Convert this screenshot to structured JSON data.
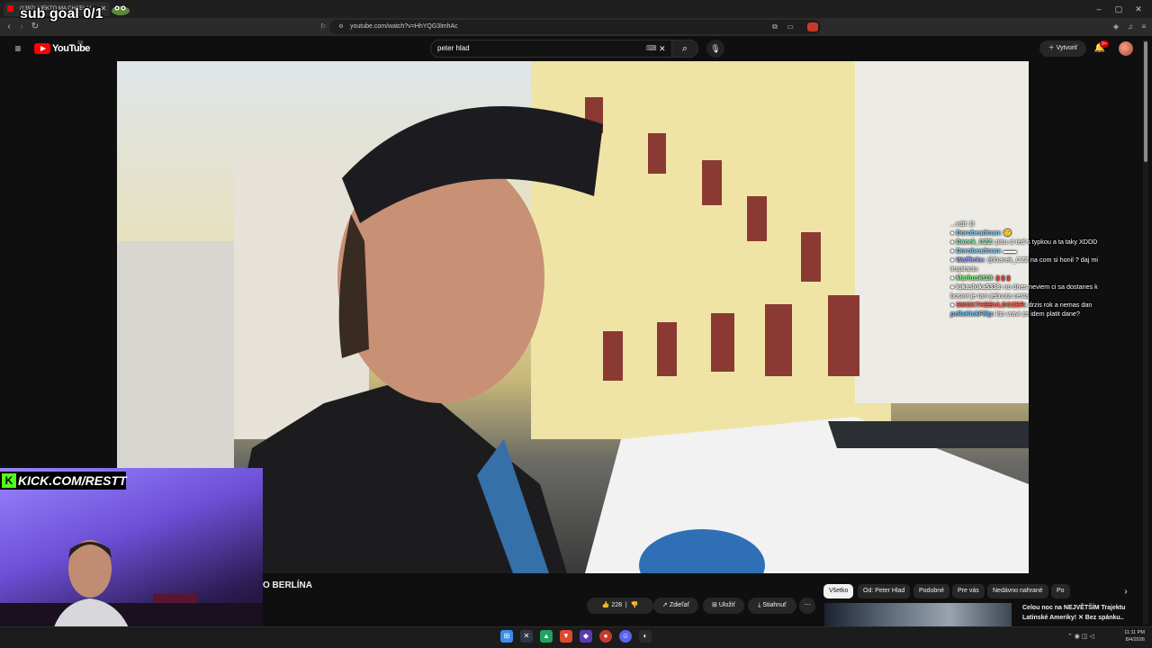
{
  "browser": {
    "tab_title": "(1397) NIEKTO MA CHCEL V...",
    "url": "youtube.com/watch?v=HhYQG3lmhAc"
  },
  "overlay": {
    "sub_goal": "sub goal 0/1",
    "kick_text": "KICK.COM/RESTT",
    "kick_logo": "K"
  },
  "youtube": {
    "logo_text": "YouTube",
    "region": "SK",
    "search_value": "peter hlad",
    "create_label": "Vytvoriť",
    "notif_badge": "9+"
  },
  "chat": [
    {
      "user": "",
      "msg": "...xdd :D",
      "color": "#ffffff"
    },
    {
      "user": "Dorobeadman:",
      "msg": "🙂",
      "color": "#7fd4ff"
    },
    {
      "user": "Danek_CZZ:",
      "msg": "pisu si teď s typkou a ta taky XDDD",
      "color": "#7fffb0"
    },
    {
      "user": "Dorobeadman:",
      "msg": "▬▬",
      "color": "#7fd4ff"
    },
    {
      "user": "WaffleXx:",
      "msg": "@Danek_CZZ na com si honil ? daj mi inspiraciu",
      "color": "#9aa8ff"
    },
    {
      "user": "Marhuskt19:",
      "msg": "▮ ▮ ▮",
      "color": "#7fff7f"
    },
    {
      "user": "lukasluka5338:",
      "msg": "no dnes neviem ci sa dostanes k bosovi je tam jebnuta cesta",
      "color": "#ffffff"
    },
    {
      "user": "SMOKTHEBULDOZER:",
      "msg": "drzis rok a nemas dan",
      "color": "#ff5a4a"
    },
    {
      "user": "pellxKickFilip:",
      "msg": "kto vravi ze idem platit dane?",
      "color": "#5fc8ff"
    }
  ],
  "video": {
    "title": "O BERLÍNA",
    "likes": "228",
    "share_label": "Zdieľať",
    "save_label": "Uložiť",
    "download_label": "Stiahnuť",
    "more_label": "⋯"
  },
  "chips": [
    "Všetko",
    "Od: Peter Hlad",
    "Podobné",
    "Pre vás",
    "Nedávno nahrané",
    "Po"
  ],
  "recommendation": {
    "title": "Celou noc na NEJVĚTŠÍM Trajektu Latinské Ameriky! ✕ Bez spánku.."
  },
  "clock": {
    "time": "11:11 PM",
    "date": "8/4/2026"
  },
  "colors": {
    "youtube_red": "#ff0000",
    "kick_green": "#53fc18"
  }
}
